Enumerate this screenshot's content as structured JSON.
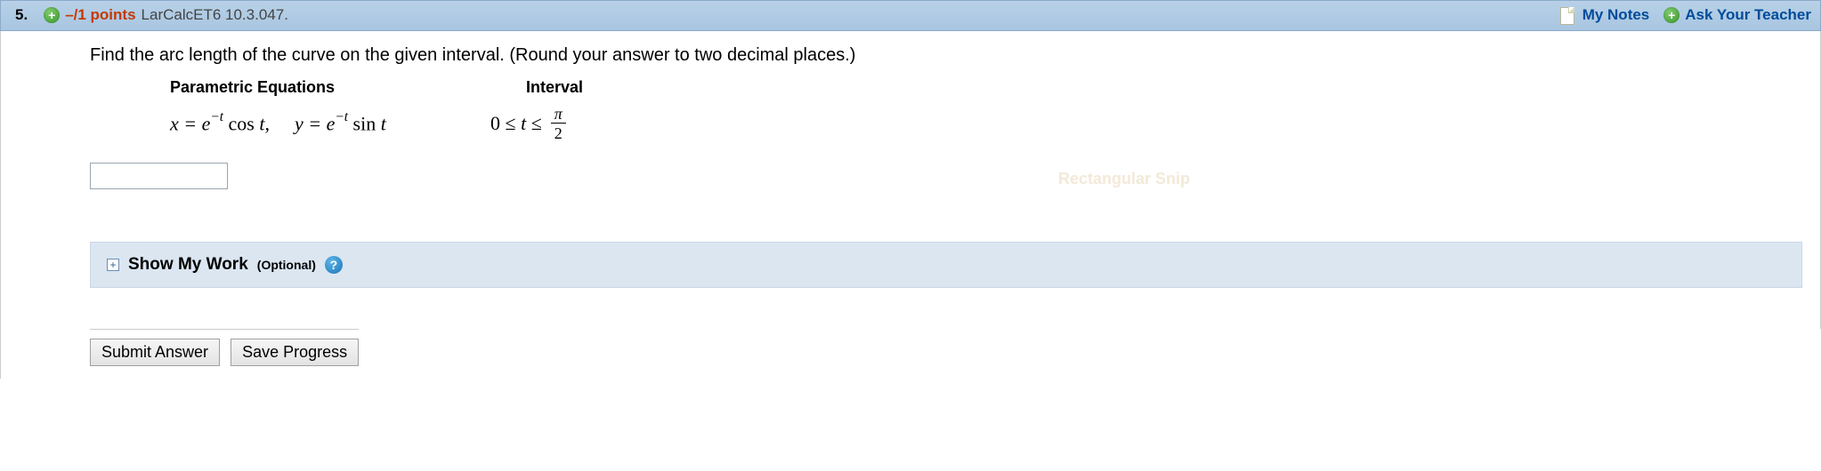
{
  "header": {
    "number": "5.",
    "points_label": "–/1 points",
    "source": "LarCalcET6 10.3.047.",
    "my_notes": "My Notes",
    "ask_teacher": "Ask Your Teacher"
  },
  "question": {
    "prompt": "Find the arc length of the curve on the given interval. (Round your answer to two decimal places.)",
    "col1_header": "Parametric Equations",
    "col2_header": "Interval",
    "eq_x_lhs": "x = e",
    "eq_x_exp": "−t",
    "eq_x_rhs": " cos t,",
    "eq_y_lhs": "y = e",
    "eq_y_exp": "−t",
    "eq_y_rhs": " sin t",
    "interval_prefix": "0 ≤ t ≤",
    "interval_num": "π",
    "interval_den": "2",
    "answer_value": "",
    "watermark": "Rectangular Snip"
  },
  "show_work": {
    "label": "Show My Work",
    "optional": "(Optional)"
  },
  "buttons": {
    "submit": "Submit Answer",
    "save": "Save Progress"
  }
}
